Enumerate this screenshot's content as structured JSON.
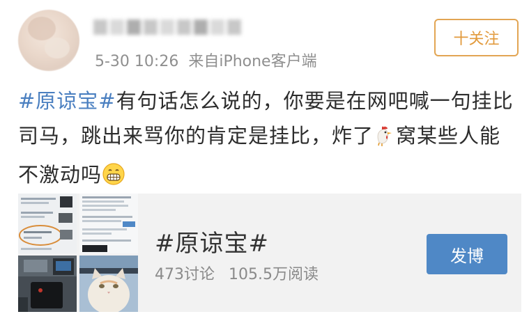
{
  "header": {
    "username": "",
    "time": "5-30 10:26",
    "source": "来自iPhone客户端",
    "follow_label": "十关注"
  },
  "post": {
    "topic_tag": "#原谅宝#",
    "text_part1": "有句话怎么说的，你要是在网吧喊一句挂比司马，跳出来骂你的肯定是挂比，炸了",
    "text_part2": "窝某些人能不激动吗",
    "emojis": [
      "rooster-emoji",
      "grin-emoji"
    ]
  },
  "card": {
    "title": "#原谅宝#",
    "discussions": "473讨论",
    "reads": "105.5万阅读",
    "post_button_label": "发博",
    "thumbnails": [
      "screenshot-thumbnail",
      "screenshot-thumbnail",
      "desk-photo-thumbnail",
      "cat-photo-thumbnail"
    ]
  },
  "colors": {
    "link": "#4a7fc0",
    "follow_border": "#e2a553",
    "button_blue": "#4f88c6",
    "meta_gray": "#8f8f8f"
  }
}
